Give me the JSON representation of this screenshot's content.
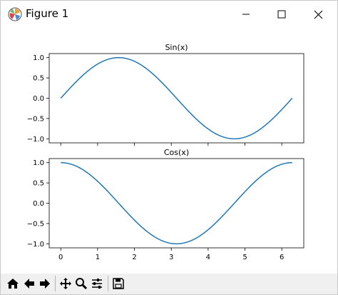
{
  "window": {
    "title": "Figure 1",
    "controls": [
      "minimize-icon",
      "maximize-icon",
      "close-icon"
    ],
    "app_icon": "matplotlib-icon"
  },
  "toolbar": {
    "buttons": [
      "home-icon",
      "back-arrow-icon",
      "forward-arrow-icon",
      "pan-icon",
      "zoom-icon",
      "configure-subplots-icon",
      "save-icon"
    ]
  },
  "colors": {
    "line": "#1f77b4",
    "axes": "#000000",
    "toolbar_bg": "#f0f0f0"
  },
  "chart_data": [
    {
      "type": "line",
      "title": "Sin(x)",
      "function": "sin",
      "x_range": [
        0,
        6.283
      ],
      "xlim": [
        -0.314,
        6.597
      ],
      "ylim": [
        -1.1,
        1.1
      ],
      "xticks": [
        0,
        1,
        2,
        3,
        4,
        5,
        6
      ],
      "xtick_labels_shown": false,
      "yticks": [
        1.0,
        0.5,
        0.0,
        -0.5,
        -1.0
      ],
      "ytick_labels": [
        "1.0",
        "0.5",
        "0.0",
        "−0.5",
        "−1.0"
      ],
      "x": [
        0,
        0.5,
        1,
        1.5,
        1.571,
        2,
        2.5,
        3,
        3.5,
        4,
        4.5,
        4.712,
        5,
        5.5,
        6,
        6.283
      ],
      "y": [
        0,
        0.479,
        0.841,
        0.997,
        1.0,
        0.909,
        0.598,
        0.141,
        -0.351,
        -0.757,
        -0.978,
        -1.0,
        -0.959,
        -0.706,
        -0.279,
        0
      ]
    },
    {
      "type": "line",
      "title": "Cos(x)",
      "function": "cos",
      "x_range": [
        0,
        6.283
      ],
      "xlim": [
        -0.314,
        6.597
      ],
      "ylim": [
        -1.1,
        1.1
      ],
      "xticks": [
        0,
        1,
        2,
        3,
        4,
        5,
        6
      ],
      "xtick_labels": [
        "0",
        "1",
        "2",
        "3",
        "4",
        "5",
        "6"
      ],
      "yticks": [
        1.0,
        0.5,
        0.0,
        -0.5,
        -1.0
      ],
      "ytick_labels": [
        "1.0",
        "0.5",
        "0.0",
        "−0.5",
        "−1.0"
      ],
      "x": [
        0,
        0.5,
        1,
        1.5,
        2,
        2.5,
        3,
        3.142,
        3.5,
        4,
        4.5,
        5,
        5.5,
        6,
        6.283
      ],
      "y": [
        1,
        0.878,
        0.54,
        0.071,
        -0.416,
        -0.801,
        -0.99,
        -1.0,
        -0.936,
        -0.654,
        -0.211,
        0.284,
        0.709,
        0.96,
        1
      ]
    }
  ]
}
